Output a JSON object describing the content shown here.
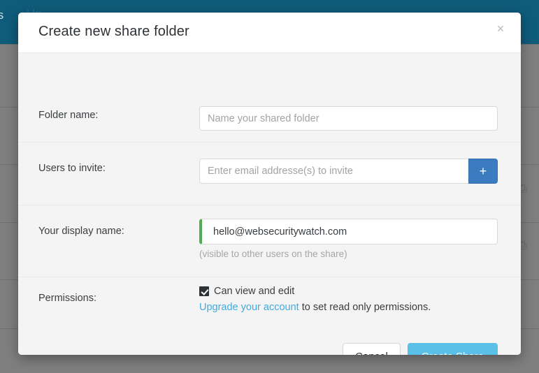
{
  "background": {
    "topbar_text_left": "nts",
    "topbar_text_right": "Up",
    "row_glyph": "⎙"
  },
  "modal": {
    "title": "Create new share folder",
    "close_icon": "×",
    "fields": {
      "folder_name": {
        "label": "Folder name:",
        "placeholder": "Name your shared folder",
        "value": ""
      },
      "users_to_invite": {
        "label": "Users to invite:",
        "placeholder": "Enter email addresse(s) to invite",
        "value": "",
        "add_button_label": "+"
      },
      "display_name": {
        "label": "Your display name:",
        "value": "hello@websecuritywatch.com",
        "placeholder": "",
        "help_text": "(visible to other users on the share)",
        "valid_accent": "#4caf50"
      },
      "permissions": {
        "label": "Permissions:",
        "checkbox_label": "Can view and edit",
        "checkbox_checked": true,
        "upgrade_link_text": "Upgrade your account",
        "upgrade_suffix_text": " to set read only permissions."
      }
    },
    "footer": {
      "cancel_label": "Cancel",
      "create_label": "Create Share"
    }
  },
  "colors": {
    "topbar": "#0f5c7a",
    "overlay": "#7f7f7f",
    "primary_button": "#5bc0e8",
    "add_button": "#3b7bbf",
    "link": "#41abe1"
  }
}
